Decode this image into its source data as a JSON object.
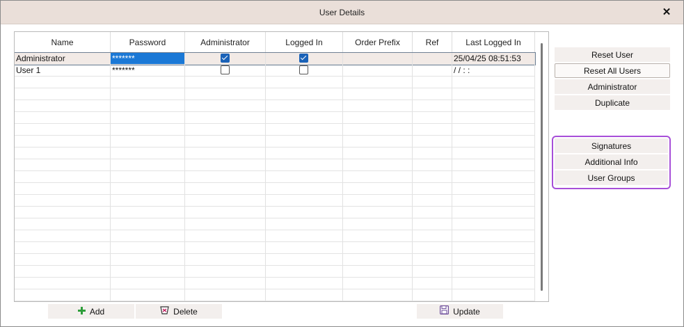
{
  "window": {
    "title": "User Details",
    "close_glyph": "✕"
  },
  "grid": {
    "columns": [
      "Name",
      "Password",
      "Administrator",
      "Logged In",
      "Order Prefix",
      "Ref",
      "Last Logged In"
    ],
    "rows": [
      {
        "name": "Administrator",
        "password": "*******",
        "administrator": true,
        "logged_in": true,
        "order_prefix": "",
        "ref": "",
        "last_logged_in": "25/04/25 08:51:53"
      },
      {
        "name": "User 1",
        "password": "*******",
        "administrator": false,
        "logged_in": false,
        "order_prefix": "",
        "ref": "",
        "last_logged_in": "/ /    : :"
      }
    ],
    "selected_row": 0
  },
  "side_buttons": [
    "Reset User",
    "Reset All Users",
    "Administrator",
    "Duplicate"
  ],
  "group_buttons": [
    "Signatures",
    "Additional Info",
    "User Groups"
  ],
  "bottom_buttons": {
    "add": "Add",
    "delete": "Delete",
    "update": "Update"
  },
  "icons": {
    "add": "plus-icon",
    "delete": "trash-icon",
    "update": "save-icon"
  },
  "colors": {
    "highlight": "#a74fd8",
    "selection": "#1a78d6",
    "add_icon": "#2e9d3a"
  }
}
